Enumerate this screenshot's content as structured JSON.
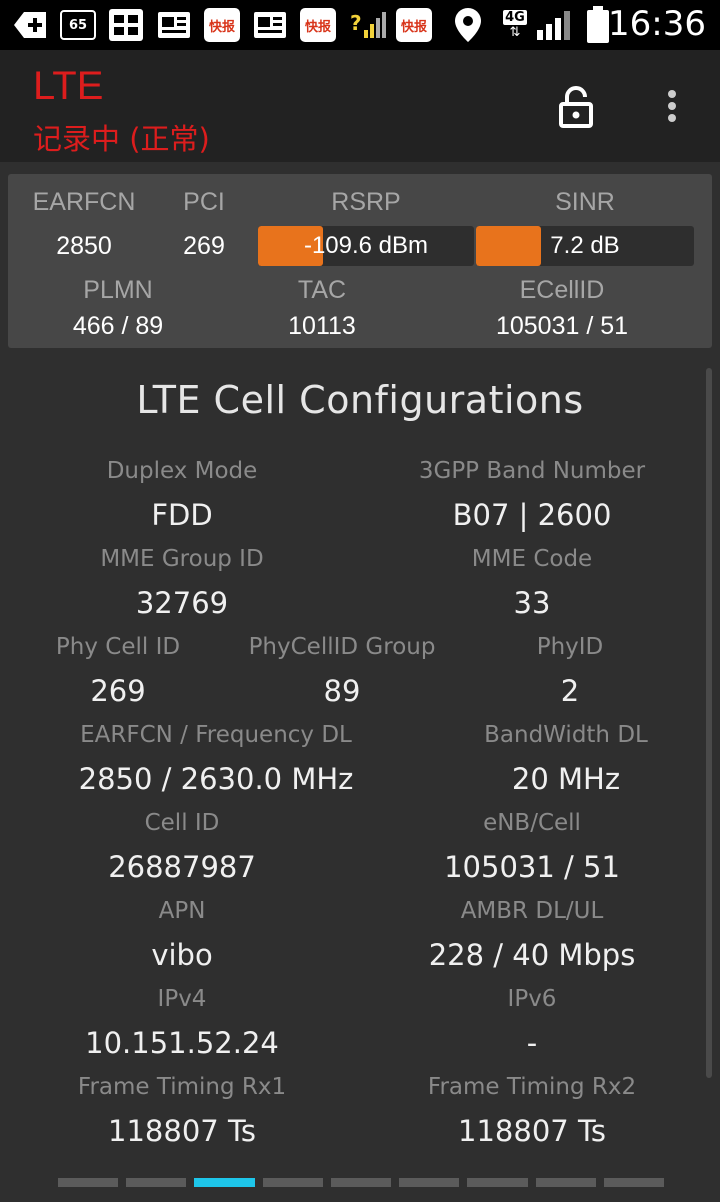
{
  "statusbar": {
    "icons": [
      "add-box-icon",
      "badge-65-icon",
      "mms-icon",
      "news-icon",
      "news-app-icon",
      "news-icon",
      "news-app-icon",
      "signal-question-icon",
      "news-app-icon",
      "location-pin-icon",
      "network-4g-icon",
      "signal-bars-icon",
      "battery-icon"
    ],
    "badge": "65",
    "news_app_text": "快报",
    "net_label": "4G",
    "time": "16:36"
  },
  "appbar": {
    "title": "LTE",
    "subtitle": "记录中 (正常)",
    "title_color": "#dd1d1d"
  },
  "summary": {
    "earfcn": {
      "label": "EARFCN",
      "value": "2850"
    },
    "pci": {
      "label": "PCI",
      "value": "269"
    },
    "rsrp": {
      "label": "RSRP",
      "value": "-109.6 dBm",
      "level": 0.3
    },
    "sinr": {
      "label": "SINR",
      "value": "7.2 dB",
      "level": 0.3
    },
    "plmn": {
      "label": "PLMN",
      "value": "466 / 89"
    },
    "tac": {
      "label": "TAC",
      "value": "10113"
    },
    "ecellid": {
      "label": "ECellID",
      "value": "105031 / 51"
    },
    "bar_color": "#e8731c"
  },
  "config": {
    "title": "LTE Cell Configurations",
    "duplex_mode": {
      "label": "Duplex Mode",
      "value": "FDD"
    },
    "band_number": {
      "label": "3GPP Band Number",
      "value": "B07 | 2600"
    },
    "mme_group_id": {
      "label": "MME Group ID",
      "value": "32769"
    },
    "mme_code": {
      "label": "MME Code",
      "value": "33"
    },
    "phy_cell_id": {
      "label": "Phy Cell ID",
      "value": "269"
    },
    "phy_cell_id_group": {
      "label": "PhyCellID Group",
      "value": "89"
    },
    "phy_id": {
      "label": "PhyID",
      "value": "2"
    },
    "earfcn_freq_dl": {
      "label": "EARFCN / Frequency DL",
      "value": "2850 / 2630.0 MHz"
    },
    "bandwidth_dl": {
      "label": "BandWidth DL",
      "value": "20 MHz"
    },
    "cell_id": {
      "label": "Cell ID",
      "value": "26887987"
    },
    "enb_cell": {
      "label": "eNB/Cell",
      "value": "105031 / 51"
    },
    "apn": {
      "label": "APN",
      "value": "vibo"
    },
    "ambr": {
      "label": "AMBR DL/UL",
      "value": "228 / 40 Mbps"
    },
    "ipv4": {
      "label": "IPv4",
      "value": "10.151.52.24"
    },
    "ipv6": {
      "label": "IPv6",
      "value": "-"
    },
    "frame_timing_rx1": {
      "label": "Frame Timing Rx1",
      "value": "118807 Ts"
    },
    "frame_timing_rx2": {
      "label": "Frame Timing Rx2",
      "value": "118807 Ts"
    }
  },
  "pager": {
    "pages": 9,
    "active_index": 2,
    "active_color": "#1ec6ea"
  }
}
